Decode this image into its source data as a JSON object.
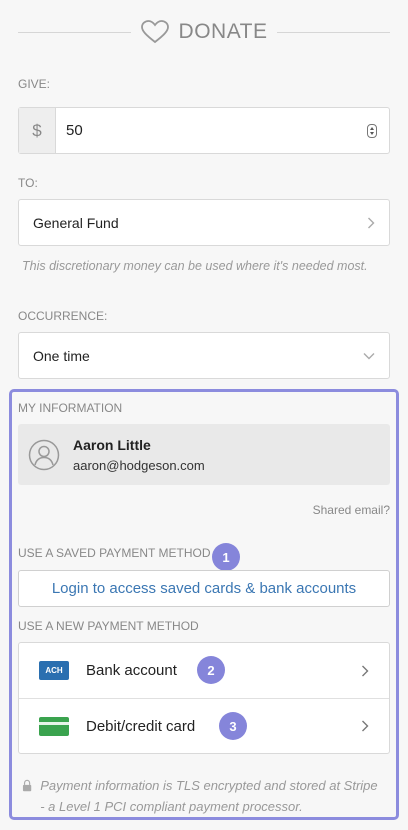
{
  "header": {
    "title": "DONATE",
    "icon": "heart-icon"
  },
  "give": {
    "label": "GIVE:",
    "currency": "$",
    "amount": "50"
  },
  "to": {
    "label": "TO:",
    "value": "General Fund",
    "helper": "This discretionary money can be used where it's needed most."
  },
  "occurrence": {
    "label": "OCCURRENCE:",
    "value": "One time"
  },
  "my_info": {
    "label": "MY INFORMATION",
    "name": "Aaron Little",
    "email": "aaron@hodgeson.com",
    "shared_email": "Shared email?"
  },
  "saved_payment": {
    "label": "USE A SAVED PAYMENT METHOD",
    "badge": "1",
    "login_button": "Login to access saved cards & bank accounts"
  },
  "new_payment": {
    "label": "USE A NEW PAYMENT METHOD",
    "items": [
      {
        "icon_text": "ACH",
        "label": "Bank account",
        "badge": "2"
      },
      {
        "label": "Debit/credit card",
        "badge": "3"
      }
    ]
  },
  "security_note": "Payment information is TLS encrypted and stored at Stripe - a Level 1 PCI compliant payment processor.",
  "colors": {
    "accent": "#8c8cde",
    "badge": "#8585da",
    "link": "#3b77b3",
    "ach": "#2a6fb0",
    "card": "#3aa34e"
  }
}
